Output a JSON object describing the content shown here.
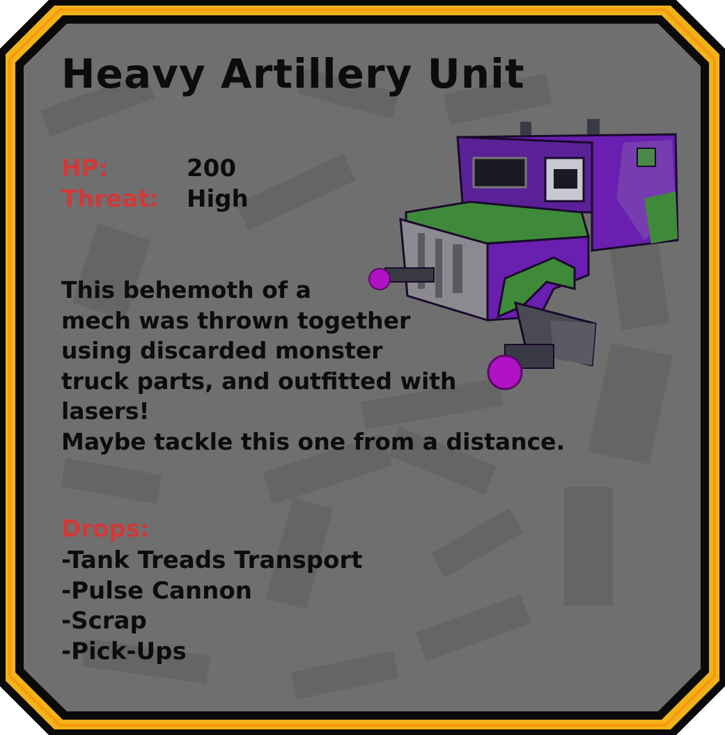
{
  "unit": {
    "title": "Heavy Artillery Unit",
    "stats": [
      {
        "label": "HP:",
        "value": "200"
      },
      {
        "label": "Threat:",
        "value": "High"
      }
    ],
    "description_lines": [
      "This behemoth of a",
      "mech was thrown together",
      "using discarded monster",
      "truck parts, and outfitted with",
      "lasers!",
      "Maybe tackle this one from a distance."
    ],
    "drops_label": "Drops:",
    "drops": [
      "-Tank Treads Transport",
      "-Pulse Cannon",
      "-Scrap",
      "-Pick-Ups"
    ]
  },
  "image": {
    "icon": "artillery-mech-illustration"
  },
  "colors": {
    "frame_gold": "#f2b21a",
    "frame_dark": "#0a0a0a",
    "panel": "#6f6f6f",
    "label_red": "#cf3a3a",
    "text": "#0c0c0c",
    "mech_purple": "#6a1fb0",
    "mech_green": "#3f8a3a",
    "laser_magenta": "#b012c4"
  }
}
